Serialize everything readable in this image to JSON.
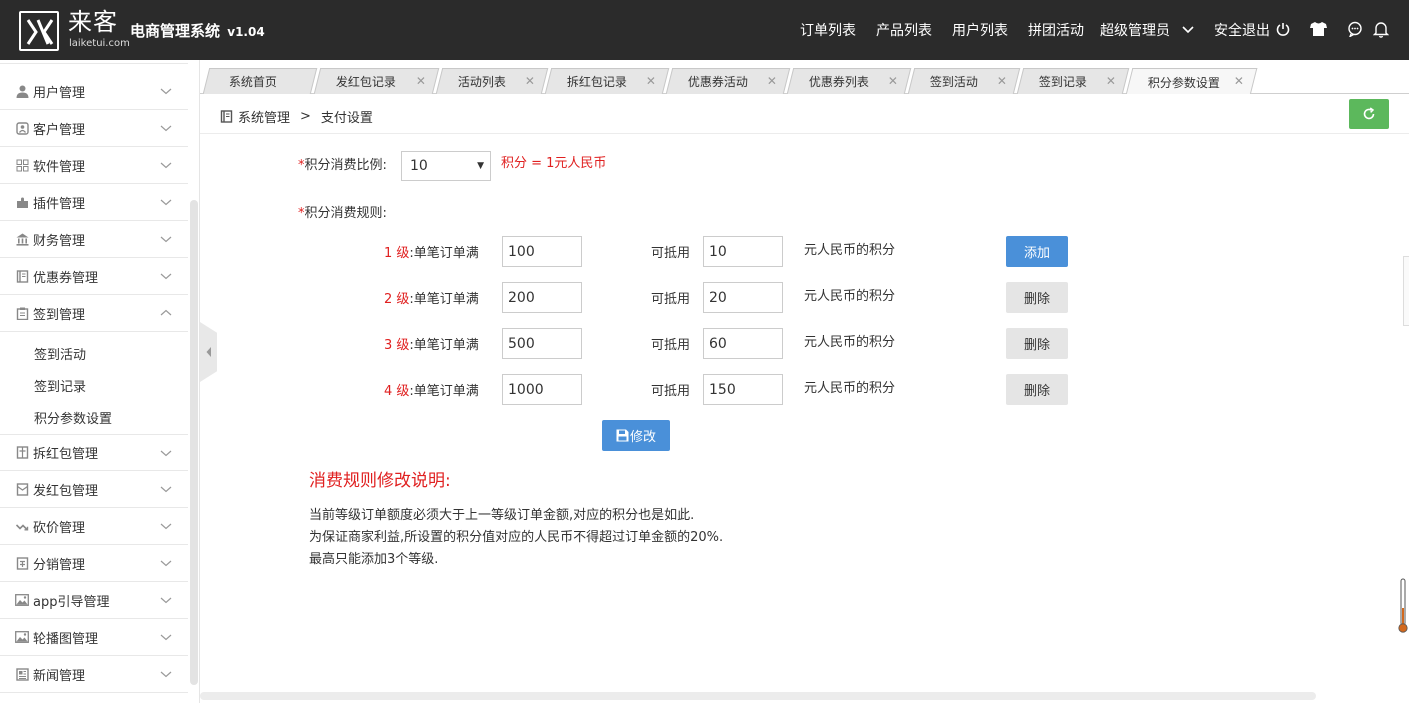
{
  "header": {
    "brand_cn": "来客",
    "brand_en": "laiketui.com",
    "title": "电商管理系统",
    "version": "v1.04",
    "nav": [
      "订单列表",
      "产品列表",
      "用户列表",
      "拼团活动"
    ],
    "admin_label": "超级管理员",
    "logout_label": "安全退出"
  },
  "sidebar": {
    "items": [
      {
        "label": "用户管理",
        "icon": "user-icon",
        "expanded": false
      },
      {
        "label": "客户管理",
        "icon": "customer-icon",
        "expanded": false
      },
      {
        "label": "软件管理",
        "icon": "grid-icon",
        "expanded": false
      },
      {
        "label": "插件管理",
        "icon": "puzzle-icon",
        "expanded": false
      },
      {
        "label": "财务管理",
        "icon": "bank-icon",
        "expanded": false
      },
      {
        "label": "优惠券管理",
        "icon": "book-icon",
        "expanded": false
      },
      {
        "label": "签到管理",
        "icon": "clipboard-icon",
        "expanded": true
      },
      {
        "label": "拆红包管理",
        "icon": "gift-icon",
        "expanded": false
      },
      {
        "label": "发红包管理",
        "icon": "envelope-icon",
        "expanded": false
      },
      {
        "label": "砍价管理",
        "icon": "trend-icon",
        "expanded": false
      },
      {
        "label": "分销管理",
        "icon": "share-icon",
        "expanded": false
      },
      {
        "label": "app引导管理",
        "icon": "image-icon",
        "expanded": false
      },
      {
        "label": "轮播图管理",
        "icon": "image-icon",
        "expanded": false
      },
      {
        "label": "新闻管理",
        "icon": "news-icon",
        "expanded": false
      }
    ],
    "subitems": [
      "签到活动",
      "签到记录",
      "积分参数设置"
    ]
  },
  "tabs": [
    {
      "label": "系统首页",
      "closable": false
    },
    {
      "label": "发红包记录",
      "closable": true
    },
    {
      "label": "活动列表",
      "closable": true
    },
    {
      "label": "拆红包记录",
      "closable": true
    },
    {
      "label": "优惠券活动",
      "closable": true
    },
    {
      "label": "优惠券列表",
      "closable": true
    },
    {
      "label": "签到活动",
      "closable": true
    },
    {
      "label": "签到记录",
      "closable": true
    },
    {
      "label": "积分参数设置",
      "closable": true,
      "active": true
    }
  ],
  "breadcrumb": {
    "root": "系统管理",
    "sep": ">",
    "current": "支付设置"
  },
  "form": {
    "ratio_label": "积分消费比例:",
    "ratio_value": "10",
    "ratio_hint": "积分 = 1元人民币",
    "rules_label": "积分消费规则:",
    "rules": [
      {
        "level": "1 级",
        "min_label": ":单笔订单满",
        "min": "100",
        "deduct_label": "可抵用",
        "points": "10",
        "unit": "元人民币的积分",
        "action": "添加"
      },
      {
        "level": "2 级",
        "min_label": ":单笔订单满",
        "min": "200",
        "deduct_label": "可抵用",
        "points": "20",
        "unit": "元人民币的积分",
        "action": "删除"
      },
      {
        "level": "3 级",
        "min_label": ":单笔订单满",
        "min": "500",
        "deduct_label": "可抵用",
        "points": "60",
        "unit": "元人民币的积分",
        "action": "删除"
      },
      {
        "level": "4 级",
        "min_label": ":单笔订单满",
        "min": "1000",
        "deduct_label": "可抵用",
        "points": "150",
        "unit": "元人民币的积分",
        "action": "删除"
      }
    ],
    "submit_label": "修改"
  },
  "notes": {
    "title": "消费规则修改说明:",
    "lines": [
      "当前等级订单额度必须大于上一等级订单金额,对应的积分也是如此.",
      "为保证商家利益,所设置的积分值对应的人民币不得超过订单金额的20%.",
      "最高只能添加3个等级."
    ]
  },
  "colors": {
    "header_bg": "#2b2b2b",
    "primary": "#4a90d9",
    "success": "#5cb85c",
    "danger": "#e02020"
  }
}
